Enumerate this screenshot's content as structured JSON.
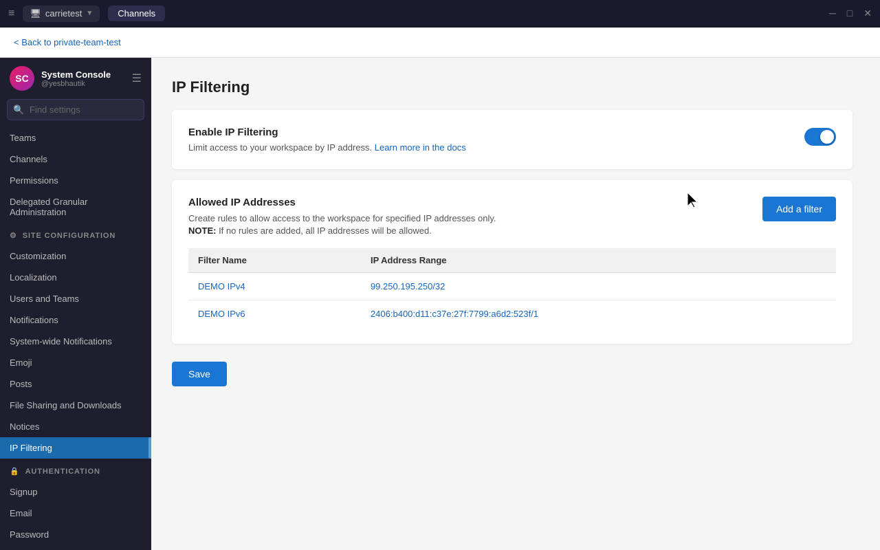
{
  "titlebar": {
    "menu_icon": "≡",
    "workspace": "carrietest",
    "workspace_chevron": "▼",
    "tab": "Channels",
    "controls": {
      "minimize": "─",
      "maximize": "□",
      "close": "✕"
    }
  },
  "backbar": {
    "back_label": "< Back to private-team-test"
  },
  "sidebar": {
    "user_name": "System Console",
    "user_handle": "@yesbhautik",
    "user_initials": "SC",
    "search_placeholder": "Find settings",
    "items": [
      {
        "id": "teams",
        "label": "Teams",
        "section": false
      },
      {
        "id": "channels",
        "label": "Channels",
        "section": false
      },
      {
        "id": "permissions",
        "label": "Permissions",
        "section": false
      },
      {
        "id": "delegated",
        "label": "Delegated Granular Administration",
        "section": false
      },
      {
        "id": "site-config",
        "label": "SITE CONFIGURATION",
        "section": true,
        "icon": "⚙"
      },
      {
        "id": "customization",
        "label": "Customization",
        "section": false
      },
      {
        "id": "localization",
        "label": "Localization",
        "section": false
      },
      {
        "id": "users-teams",
        "label": "Users and Teams",
        "section": false
      },
      {
        "id": "notifications",
        "label": "Notifications",
        "section": false
      },
      {
        "id": "system-wide-notifications",
        "label": "System-wide Notifications",
        "section": false
      },
      {
        "id": "emoji",
        "label": "Emoji",
        "section": false
      },
      {
        "id": "posts",
        "label": "Posts",
        "section": false
      },
      {
        "id": "file-sharing",
        "label": "File Sharing and Downloads",
        "section": false
      },
      {
        "id": "notices",
        "label": "Notices",
        "section": false
      },
      {
        "id": "ip-filtering",
        "label": "IP Filtering",
        "section": false,
        "active": true
      },
      {
        "id": "authentication",
        "label": "AUTHENTICATION",
        "section": true,
        "icon": "🔒"
      },
      {
        "id": "signup",
        "label": "Signup",
        "section": false
      },
      {
        "id": "email",
        "label": "Email",
        "section": false
      },
      {
        "id": "password",
        "label": "Password",
        "section": false
      }
    ]
  },
  "page": {
    "title": "IP Filtering",
    "enable_section": {
      "label": "Enable IP Filtering",
      "description_prefix": "Limit access to your workspace by IP address.",
      "description_link_text": "Learn more in the docs",
      "description_link_url": "#",
      "enabled": true
    },
    "allowed_section": {
      "title": "Allowed IP Addresses",
      "description": "Create rules to allow access to the workspace for specified IP addresses only.",
      "note_prefix": "NOTE:",
      "note_text": " If no rules are added, all IP addresses will be allowed.",
      "add_filter_label": "Add a filter",
      "table": {
        "col_filter_name": "Filter Name",
        "col_ip_range": "IP Address Range",
        "rows": [
          {
            "filter_name": "DEMO IPv4",
            "ip_range": "99.250.195.250/32"
          },
          {
            "filter_name": "DEMO IPv6",
            "ip_range": "2406:b400:d11:c37e:27f:7799:a6d2:523f/1"
          }
        ]
      }
    },
    "save_label": "Save"
  }
}
